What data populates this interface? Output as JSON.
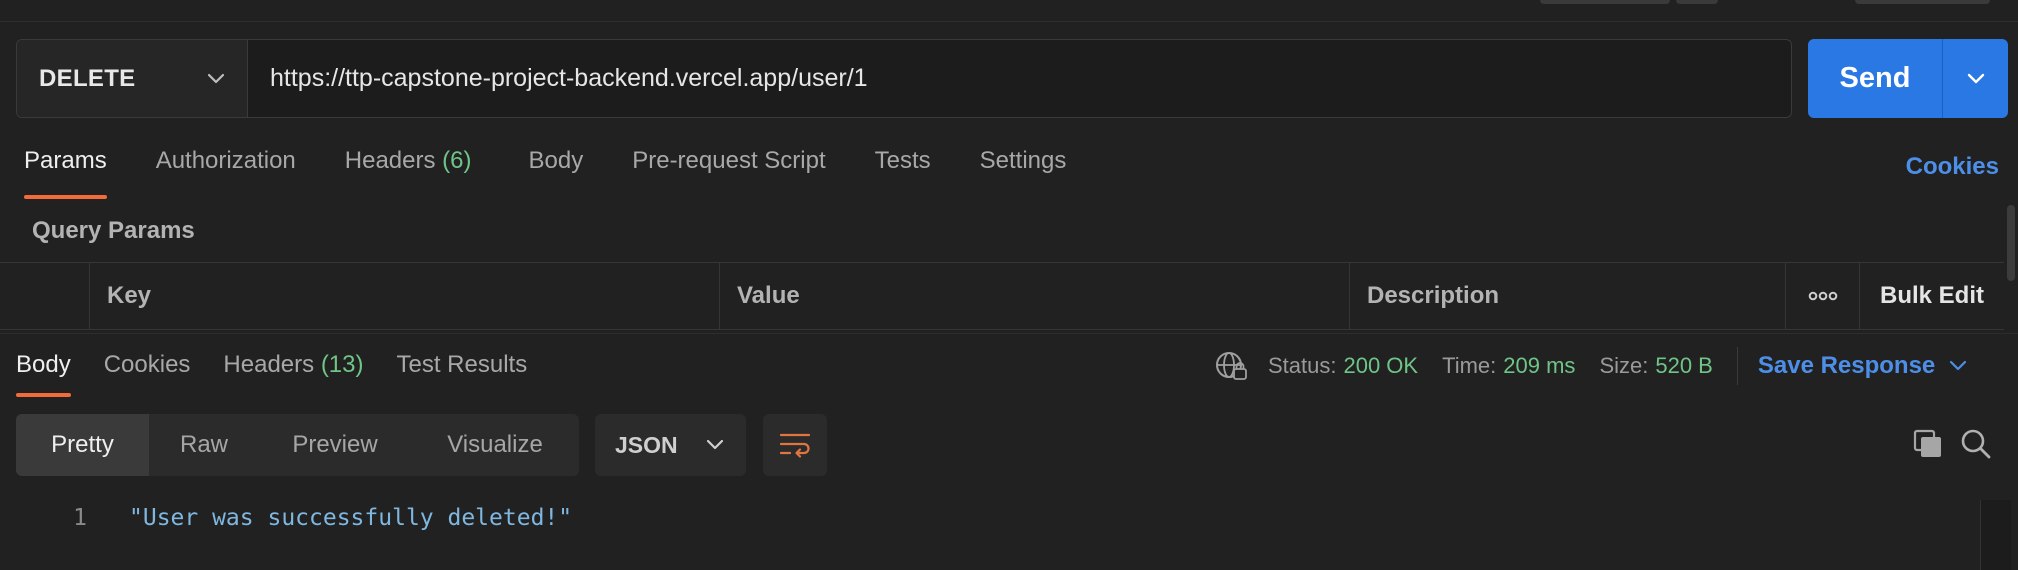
{
  "request": {
    "method": "DELETE",
    "url": "https://ttp-capstone-project-backend.vercel.app/user/1",
    "send_label": "Send"
  },
  "request_tabs": [
    {
      "label": "Params",
      "active": true
    },
    {
      "label": "Authorization"
    },
    {
      "label": "Headers",
      "count": "(6)"
    },
    {
      "label": "Body"
    },
    {
      "label": "Pre-request Script"
    },
    {
      "label": "Tests"
    },
    {
      "label": "Settings"
    }
  ],
  "cookies_label": "Cookies",
  "query_params": {
    "title": "Query Params",
    "columns": [
      "Key",
      "Value",
      "Description"
    ],
    "bulk_edit": "Bulk Edit"
  },
  "response_tabs": [
    {
      "label": "Body",
      "active": true
    },
    {
      "label": "Cookies"
    },
    {
      "label": "Headers",
      "count": "(13)"
    },
    {
      "label": "Test Results"
    }
  ],
  "status": {
    "status_label": "Status:",
    "status_value": "200 OK",
    "time_label": "Time:",
    "time_value": "209 ms",
    "size_label": "Size:",
    "size_value": "520 B",
    "save_response": "Save Response"
  },
  "format": {
    "options": [
      "Pretty",
      "Raw",
      "Preview",
      "Visualize"
    ],
    "language": "JSON"
  },
  "response_body": {
    "lines": [
      {
        "num": "1",
        "text": "\"User was successfully deleted!\""
      }
    ]
  },
  "colors": {
    "accent": "#2a78e4",
    "tab_indicator": "#f26b3a",
    "success": "#6fc587",
    "link": "#4d8fe8",
    "string": "#7fb7e0"
  },
  "icons": [
    "chevron-down-icon",
    "globe-lock-icon",
    "wrap-lines-icon",
    "copy-icon",
    "search-icon",
    "more-dots-icon"
  ]
}
